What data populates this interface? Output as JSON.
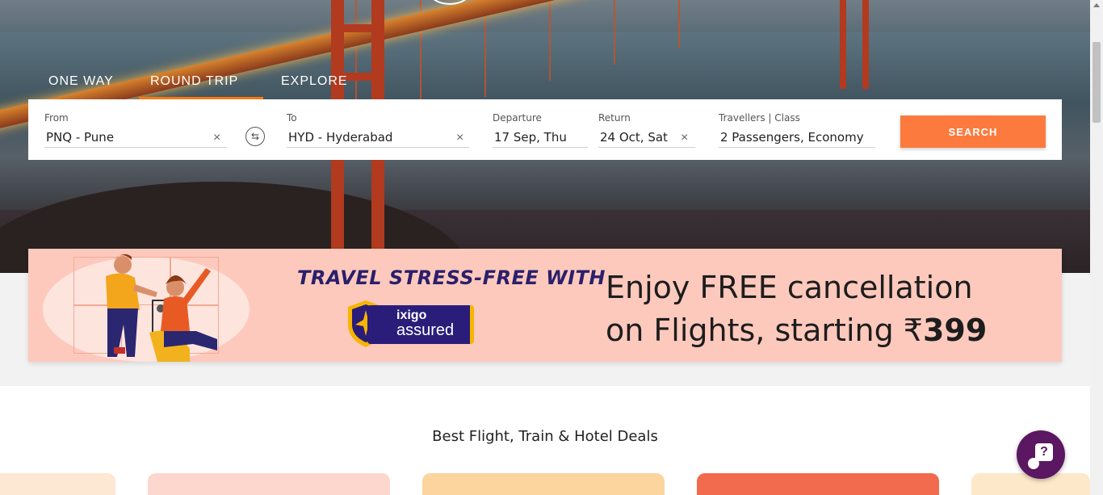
{
  "tabs": [
    {
      "label": "ONE WAY"
    },
    {
      "label": "ROUND TRIP",
      "active": true
    },
    {
      "label": "EXPLORE"
    }
  ],
  "search": {
    "from_label": "From",
    "from_value": "PNQ - Pune",
    "to_label": "To",
    "to_value": "HYD - Hyderabad",
    "departure_label": "Departure",
    "departure_value": "17 Sep, Thu",
    "return_label": "Return",
    "return_value": "24 Oct, Sat",
    "travellers_label": "Travellers | Class",
    "travellers_value": "2 Passengers, Economy",
    "button_label": "SEARCH",
    "clear_icon": "×",
    "swap_icon": "⇆"
  },
  "banner": {
    "headline": "TRAVEL STRESS-FREE WITH",
    "brand_top": "ixigo",
    "brand_bottom": "assured",
    "offer_line1": "Enjoy FREE cancellation",
    "offer_line2_prefix": "on Flights, starting ₹",
    "offer_price": "399"
  },
  "deals": {
    "title": "Best Flight, Train & Hotel Deals"
  },
  "chat": {
    "icon": "?"
  },
  "colors": {
    "accent": "#fc7a3e",
    "tab_underline": "#fc790d",
    "banner_bg": "#fec9bd",
    "brand_purple": "#2a1d7a",
    "chat_bg": "#5b1761"
  }
}
